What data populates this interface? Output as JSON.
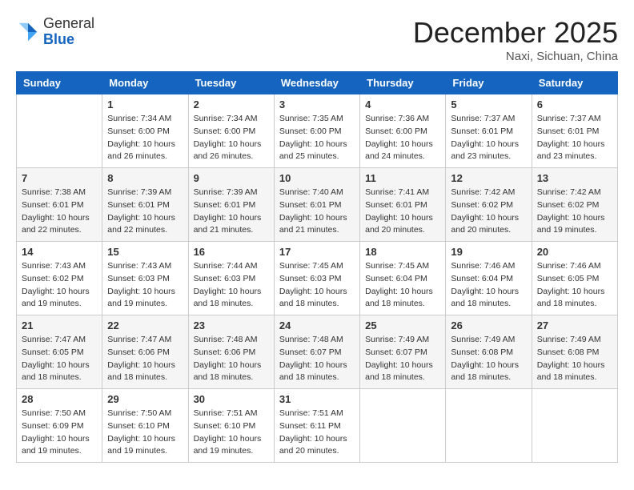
{
  "header": {
    "logo_general": "General",
    "logo_blue": "Blue",
    "month_title": "December 2025",
    "subtitle": "Naxi, Sichuan, China"
  },
  "days_of_week": [
    "Sunday",
    "Monday",
    "Tuesday",
    "Wednesday",
    "Thursday",
    "Friday",
    "Saturday"
  ],
  "weeks": [
    [
      {
        "day": "",
        "info": ""
      },
      {
        "day": "1",
        "info": "Sunrise: 7:34 AM\nSunset: 6:00 PM\nDaylight: 10 hours\nand 26 minutes."
      },
      {
        "day": "2",
        "info": "Sunrise: 7:34 AM\nSunset: 6:00 PM\nDaylight: 10 hours\nand 26 minutes."
      },
      {
        "day": "3",
        "info": "Sunrise: 7:35 AM\nSunset: 6:00 PM\nDaylight: 10 hours\nand 25 minutes."
      },
      {
        "day": "4",
        "info": "Sunrise: 7:36 AM\nSunset: 6:00 PM\nDaylight: 10 hours\nand 24 minutes."
      },
      {
        "day": "5",
        "info": "Sunrise: 7:37 AM\nSunset: 6:01 PM\nDaylight: 10 hours\nand 23 minutes."
      },
      {
        "day": "6",
        "info": "Sunrise: 7:37 AM\nSunset: 6:01 PM\nDaylight: 10 hours\nand 23 minutes."
      }
    ],
    [
      {
        "day": "7",
        "info": "Sunrise: 7:38 AM\nSunset: 6:01 PM\nDaylight: 10 hours\nand 22 minutes."
      },
      {
        "day": "8",
        "info": "Sunrise: 7:39 AM\nSunset: 6:01 PM\nDaylight: 10 hours\nand 22 minutes."
      },
      {
        "day": "9",
        "info": "Sunrise: 7:39 AM\nSunset: 6:01 PM\nDaylight: 10 hours\nand 21 minutes."
      },
      {
        "day": "10",
        "info": "Sunrise: 7:40 AM\nSunset: 6:01 PM\nDaylight: 10 hours\nand 21 minutes."
      },
      {
        "day": "11",
        "info": "Sunrise: 7:41 AM\nSunset: 6:01 PM\nDaylight: 10 hours\nand 20 minutes."
      },
      {
        "day": "12",
        "info": "Sunrise: 7:42 AM\nSunset: 6:02 PM\nDaylight: 10 hours\nand 20 minutes."
      },
      {
        "day": "13",
        "info": "Sunrise: 7:42 AM\nSunset: 6:02 PM\nDaylight: 10 hours\nand 19 minutes."
      }
    ],
    [
      {
        "day": "14",
        "info": "Sunrise: 7:43 AM\nSunset: 6:02 PM\nDaylight: 10 hours\nand 19 minutes."
      },
      {
        "day": "15",
        "info": "Sunrise: 7:43 AM\nSunset: 6:03 PM\nDaylight: 10 hours\nand 19 minutes."
      },
      {
        "day": "16",
        "info": "Sunrise: 7:44 AM\nSunset: 6:03 PM\nDaylight: 10 hours\nand 18 minutes."
      },
      {
        "day": "17",
        "info": "Sunrise: 7:45 AM\nSunset: 6:03 PM\nDaylight: 10 hours\nand 18 minutes."
      },
      {
        "day": "18",
        "info": "Sunrise: 7:45 AM\nSunset: 6:04 PM\nDaylight: 10 hours\nand 18 minutes."
      },
      {
        "day": "19",
        "info": "Sunrise: 7:46 AM\nSunset: 6:04 PM\nDaylight: 10 hours\nand 18 minutes."
      },
      {
        "day": "20",
        "info": "Sunrise: 7:46 AM\nSunset: 6:05 PM\nDaylight: 10 hours\nand 18 minutes."
      }
    ],
    [
      {
        "day": "21",
        "info": "Sunrise: 7:47 AM\nSunset: 6:05 PM\nDaylight: 10 hours\nand 18 minutes."
      },
      {
        "day": "22",
        "info": "Sunrise: 7:47 AM\nSunset: 6:06 PM\nDaylight: 10 hours\nand 18 minutes."
      },
      {
        "day": "23",
        "info": "Sunrise: 7:48 AM\nSunset: 6:06 PM\nDaylight: 10 hours\nand 18 minutes."
      },
      {
        "day": "24",
        "info": "Sunrise: 7:48 AM\nSunset: 6:07 PM\nDaylight: 10 hours\nand 18 minutes."
      },
      {
        "day": "25",
        "info": "Sunrise: 7:49 AM\nSunset: 6:07 PM\nDaylight: 10 hours\nand 18 minutes."
      },
      {
        "day": "26",
        "info": "Sunrise: 7:49 AM\nSunset: 6:08 PM\nDaylight: 10 hours\nand 18 minutes."
      },
      {
        "day": "27",
        "info": "Sunrise: 7:49 AM\nSunset: 6:08 PM\nDaylight: 10 hours\nand 18 minutes."
      }
    ],
    [
      {
        "day": "28",
        "info": "Sunrise: 7:50 AM\nSunset: 6:09 PM\nDaylight: 10 hours\nand 19 minutes."
      },
      {
        "day": "29",
        "info": "Sunrise: 7:50 AM\nSunset: 6:10 PM\nDaylight: 10 hours\nand 19 minutes."
      },
      {
        "day": "30",
        "info": "Sunrise: 7:51 AM\nSunset: 6:10 PM\nDaylight: 10 hours\nand 19 minutes."
      },
      {
        "day": "31",
        "info": "Sunrise: 7:51 AM\nSunset: 6:11 PM\nDaylight: 10 hours\nand 20 minutes."
      },
      {
        "day": "",
        "info": ""
      },
      {
        "day": "",
        "info": ""
      },
      {
        "day": "",
        "info": ""
      }
    ]
  ]
}
